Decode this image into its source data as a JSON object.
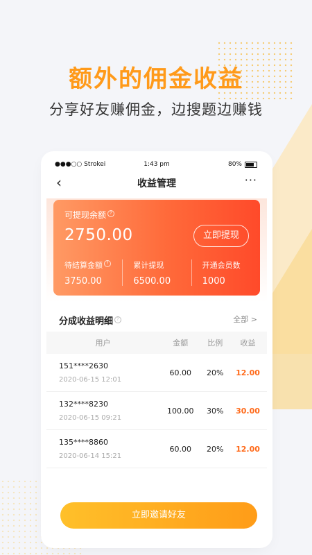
{
  "promo": {
    "headline": "额外的佣金收益",
    "subline": "分享好友赚佣金，边搜题边赚钱"
  },
  "status_bar": {
    "carrier": "●●●○○ Strokei",
    "time": "1:43 pm",
    "battery": "80%"
  },
  "nav": {
    "back_icon": "‹",
    "title": "收益管理",
    "more_icon": "···"
  },
  "card": {
    "withdrawable_label": "可提现余额",
    "withdrawable_amount": "2750.00",
    "withdraw_button": "立即提现",
    "stats": [
      {
        "label": "待结算金额",
        "value": "3750.00"
      },
      {
        "label": "累计提现",
        "value": "6500.00"
      },
      {
        "label": "开通会员数",
        "value": "1000"
      }
    ]
  },
  "detail": {
    "title": "分成收益明细",
    "all_link": "全部 >",
    "columns": [
      "用户",
      "金额",
      "比例",
      "收益"
    ],
    "rows": [
      {
        "user": "151****2630",
        "time": "2020-06-15 12:01",
        "amount": "60.00",
        "ratio": "20%",
        "gain": "12.00"
      },
      {
        "user": "132****8230",
        "time": "2020-06-15 09:21",
        "amount": "100.00",
        "ratio": "30%",
        "gain": "30.00"
      },
      {
        "user": "135****8860",
        "time": "2020-06-14 15:21",
        "amount": "60.00",
        "ratio": "20%",
        "gain": "12.00"
      }
    ]
  },
  "invite_button": "立即邀请好友",
  "colors": {
    "accent": "#ff9a1a",
    "card_gradient_start": "#ff9a64",
    "card_gradient_end": "#ff4a2a",
    "gain_text": "#ff6a1a"
  }
}
